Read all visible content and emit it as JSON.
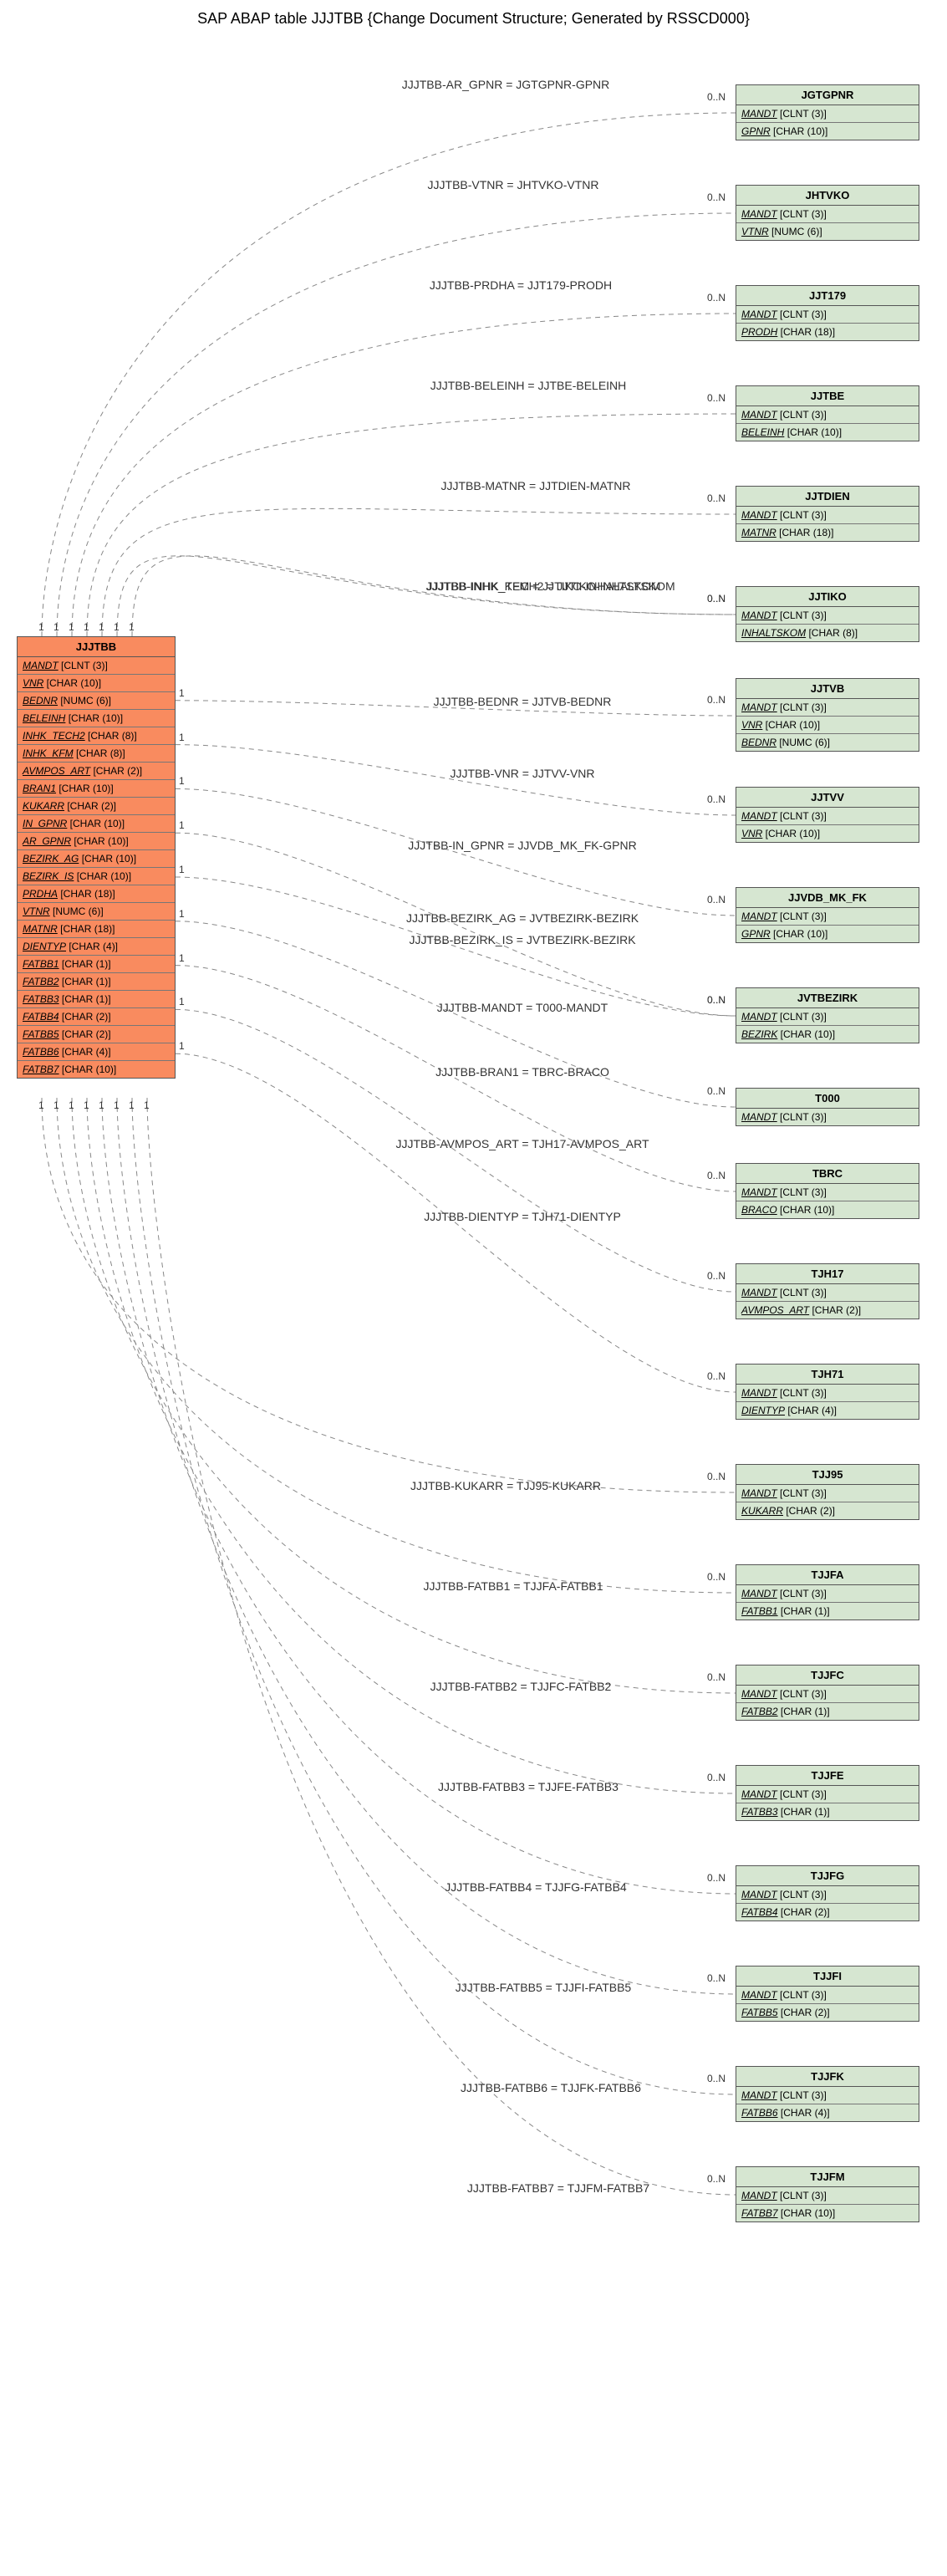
{
  "title": "SAP ABAP table JJJTBB {Change Document Structure; Generated by RSSCD000}",
  "main_entity": {
    "name": "JJJTBB",
    "fields": [
      {
        "f": "MANDT",
        "t": "[CLNT (3)]"
      },
      {
        "f": "VNR",
        "t": "[CHAR (10)]"
      },
      {
        "f": "BEDNR",
        "t": "[NUMC (6)]"
      },
      {
        "f": "BELEINH",
        "t": "[CHAR (10)]"
      },
      {
        "f": "INHK_TECH2",
        "t": "[CHAR (8)]"
      },
      {
        "f": "INHK_KFM",
        "t": "[CHAR (8)]"
      },
      {
        "f": "AVMPOS_ART",
        "t": "[CHAR (2)]"
      },
      {
        "f": "BRAN1",
        "t": "[CHAR (10)]"
      },
      {
        "f": "KUKARR",
        "t": "[CHAR (2)]"
      },
      {
        "f": "IN_GPNR",
        "t": "[CHAR (10)]"
      },
      {
        "f": "AR_GPNR",
        "t": "[CHAR (10)]"
      },
      {
        "f": "BEZIRK_AG",
        "t": "[CHAR (10)]"
      },
      {
        "f": "BEZIRK_IS",
        "t": "[CHAR (10)]"
      },
      {
        "f": "PRDHA",
        "t": "[CHAR (18)]"
      },
      {
        "f": "VTNR",
        "t": "[NUMC (6)]"
      },
      {
        "f": "MATNR",
        "t": "[CHAR (18)]"
      },
      {
        "f": "DIENTYP",
        "t": "[CHAR (4)]"
      },
      {
        "f": "FATBB1",
        "t": "[CHAR (1)]"
      },
      {
        "f": "FATBB2",
        "t": "[CHAR (1)]"
      },
      {
        "f": "FATBB3",
        "t": "[CHAR (1)]"
      },
      {
        "f": "FATBB4",
        "t": "[CHAR (2)]"
      },
      {
        "f": "FATBB5",
        "t": "[CHAR (2)]"
      },
      {
        "f": "FATBB6",
        "t": "[CHAR (4)]"
      },
      {
        "f": "FATBB7",
        "t": "[CHAR (10)]"
      }
    ]
  },
  "targets": [
    {
      "name": "JGTGPNR",
      "fields": [
        {
          "f": "MANDT",
          "t": "[CLNT (3)]"
        },
        {
          "f": "GPNR",
          "t": "[CHAR (10)]"
        }
      ]
    },
    {
      "name": "JHTVKO",
      "fields": [
        {
          "f": "MANDT",
          "t": "[CLNT (3)]"
        },
        {
          "f": "VTNR",
          "t": "[NUMC (6)]"
        }
      ]
    },
    {
      "name": "JJT179",
      "fields": [
        {
          "f": "MANDT",
          "t": "[CLNT (3)]"
        },
        {
          "f": "PRODH",
          "t": "[CHAR (18)]"
        }
      ]
    },
    {
      "name": "JJTBE",
      "fields": [
        {
          "f": "MANDT",
          "t": "[CLNT (3)]"
        },
        {
          "f": "BELEINH",
          "t": "[CHAR (10)]"
        }
      ]
    },
    {
      "name": "JJTDIEN",
      "fields": [
        {
          "f": "MANDT",
          "t": "[CLNT (3)]"
        },
        {
          "f": "MATNR",
          "t": "[CHAR (18)]"
        }
      ]
    },
    {
      "name": "JJTIKO",
      "fields": [
        {
          "f": "MANDT",
          "t": "[CLNT (3)]"
        },
        {
          "f": "INHALTSKOM",
          "t": "[CHAR (8)]"
        }
      ]
    },
    {
      "name": "JJTVB",
      "fields": [
        {
          "f": "MANDT",
          "t": "[CLNT (3)]"
        },
        {
          "f": "VNR",
          "t": "[CHAR (10)]"
        },
        {
          "f": "BEDNR",
          "t": "[NUMC (6)]"
        }
      ]
    },
    {
      "name": "JJTVV",
      "fields": [
        {
          "f": "MANDT",
          "t": "[CLNT (3)]"
        },
        {
          "f": "VNR",
          "t": "[CHAR (10)]"
        }
      ]
    },
    {
      "name": "JJVDB_MK_FK",
      "fields": [
        {
          "f": "MANDT",
          "t": "[CLNT (3)]"
        },
        {
          "f": "GPNR",
          "t": "[CHAR (10)]"
        }
      ]
    },
    {
      "name": "JVTBEZIRK",
      "fields": [
        {
          "f": "MANDT",
          "t": "[CLNT (3)]"
        },
        {
          "f": "BEZIRK",
          "t": "[CHAR (10)]"
        }
      ]
    },
    {
      "name": "T000",
      "fields": [
        {
          "f": "MANDT",
          "t": "[CLNT (3)]"
        }
      ]
    },
    {
      "name": "TBRC",
      "fields": [
        {
          "f": "MANDT",
          "t": "[CLNT (3)]"
        },
        {
          "f": "BRACO",
          "t": "[CHAR (10)]"
        }
      ]
    },
    {
      "name": "TJH17",
      "fields": [
        {
          "f": "MANDT",
          "t": "[CLNT (3)]"
        },
        {
          "f": "AVMPOS_ART",
          "t": "[CHAR (2)]"
        }
      ]
    },
    {
      "name": "TJH71",
      "fields": [
        {
          "f": "MANDT",
          "t": "[CLNT (3)]"
        },
        {
          "f": "DIENTYP",
          "t": "[CHAR (4)]"
        }
      ]
    },
    {
      "name": "TJJ95",
      "fields": [
        {
          "f": "MANDT",
          "t": "[CLNT (3)]"
        },
        {
          "f": "KUKARR",
          "t": "[CHAR (2)]"
        }
      ]
    },
    {
      "name": "TJJFA",
      "fields": [
        {
          "f": "MANDT",
          "t": "[CLNT (3)]"
        },
        {
          "f": "FATBB1",
          "t": "[CHAR (1)]"
        }
      ]
    },
    {
      "name": "TJJFC",
      "fields": [
        {
          "f": "MANDT",
          "t": "[CLNT (3)]"
        },
        {
          "f": "FATBB2",
          "t": "[CHAR (1)]"
        }
      ]
    },
    {
      "name": "TJJFE",
      "fields": [
        {
          "f": "MANDT",
          "t": "[CLNT (3)]"
        },
        {
          "f": "FATBB3",
          "t": "[CHAR (1)]"
        }
      ]
    },
    {
      "name": "TJJFG",
      "fields": [
        {
          "f": "MANDT",
          "t": "[CLNT (3)]"
        },
        {
          "f": "FATBB4",
          "t": "[CHAR (2)]"
        }
      ]
    },
    {
      "name": "TJJFI",
      "fields": [
        {
          "f": "MANDT",
          "t": "[CLNT (3)]"
        },
        {
          "f": "FATBB5",
          "t": "[CHAR (2)]"
        }
      ]
    },
    {
      "name": "TJJFK",
      "fields": [
        {
          "f": "MANDT",
          "t": "[CLNT (3)]"
        },
        {
          "f": "FATBB6",
          "t": "[CHAR (4)]"
        }
      ]
    },
    {
      "name": "TJJFM",
      "fields": [
        {
          "f": "MANDT",
          "t": "[CLNT (3)]"
        },
        {
          "f": "FATBB7",
          "t": "[CHAR (10)]"
        }
      ]
    }
  ],
  "relations": [
    {
      "label": "JJJTBB-AR_GPNR = JGTGPNR-GPNR",
      "side": "top"
    },
    {
      "label": "JJJTBB-VTNR = JHTVKO-VTNR",
      "side": "top"
    },
    {
      "label": "JJJTBB-PRDHA = JJT179-PRODH",
      "side": "top"
    },
    {
      "label": "JJJTBB-BELEINH = JJTBE-BELEINH",
      "side": "top"
    },
    {
      "label": "JJJTBB-MATNR = JJTDIEN-MATNR",
      "side": "top"
    },
    {
      "label": "JJJTBB-INHK_KFM = JJTIKO-INHALTSKOM",
      "side": "top"
    },
    {
      "label": "JJJTBB-INHK_TECH2 = JJTIKO-INHALTSKOM",
      "side": "top"
    },
    {
      "label": "JJJTBB-BEDNR = JJTVB-BEDNR",
      "side": "right"
    },
    {
      "label": "JJJTBB-VNR = JJTVV-VNR",
      "side": "right"
    },
    {
      "label": "JJJTBB-IN_GPNR = JJVDB_MK_FK-GPNR",
      "side": "right"
    },
    {
      "label": "JJJTBB-BEZIRK_AG = JVTBEZIRK-BEZIRK",
      "side": "right"
    },
    {
      "label": "JJJTBB-BEZIRK_IS = JVTBEZIRK-BEZIRK",
      "side": "right"
    },
    {
      "label": "JJJTBB-MANDT = T000-MANDT",
      "side": "right"
    },
    {
      "label": "JJJTBB-BRAN1 = TBRC-BRACO",
      "side": "right"
    },
    {
      "label": "JJJTBB-AVMPOS_ART = TJH17-AVMPOS_ART",
      "side": "right"
    },
    {
      "label": "JJJTBB-DIENTYP = TJH71-DIENTYP",
      "side": "right"
    },
    {
      "label": "JJJTBB-KUKARR = TJJ95-KUKARR",
      "side": "bottom"
    },
    {
      "label": "JJJTBB-FATBB1 = TJJFA-FATBB1",
      "side": "bottom"
    },
    {
      "label": "JJJTBB-FATBB2 = TJJFC-FATBB2",
      "side": "bottom"
    },
    {
      "label": "JJJTBB-FATBB3 = TJJFE-FATBB3",
      "side": "bottom"
    },
    {
      "label": "JJJTBB-FATBB4 = TJJFG-FATBB4",
      "side": "bottom"
    },
    {
      "label": "JJJTBB-FATBB5 = TJJFI-FATBB5",
      "side": "bottom"
    },
    {
      "label": "JJJTBB-FATBB6 = TJJFK-FATBB6",
      "side": "bottom"
    },
    {
      "label": "JJJTBB-FATBB7 = TJJFM-FATBB7",
      "side": "bottom"
    }
  ],
  "card_source_top": [
    "1",
    "1",
    "1",
    "1",
    "1",
    "1",
    "1"
  ],
  "card_source_bottom": [
    "1",
    "1",
    "1",
    "1",
    "1",
    "1",
    "1",
    "1"
  ],
  "card_source_right_1": "1",
  "card_target": "0..N"
}
